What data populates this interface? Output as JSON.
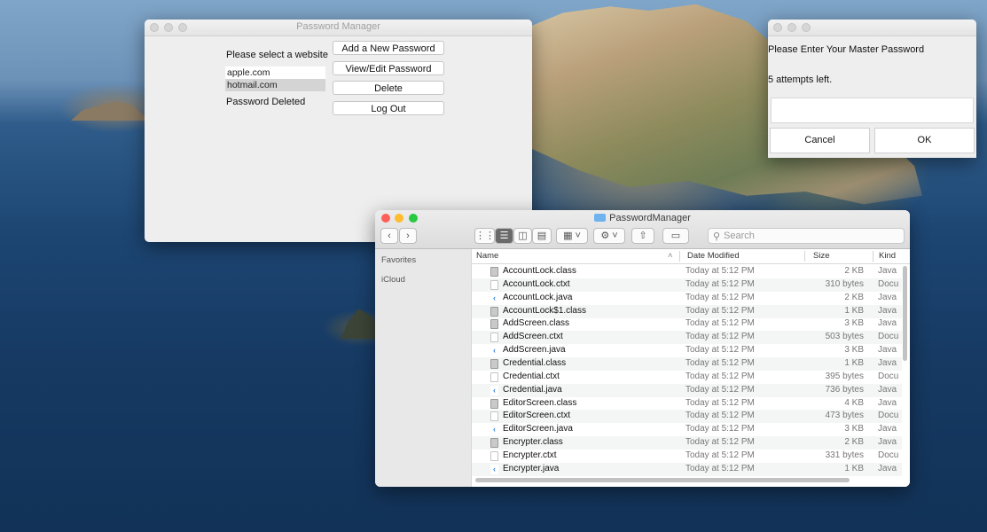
{
  "password_manager": {
    "title": "Password Manager",
    "prompt": "Please select a website",
    "websites": [
      "apple.com",
      "hotmail.com"
    ],
    "selected_index": 1,
    "status": "Password Deleted",
    "buttons": [
      "Add a New Password",
      "View/Edit Password",
      "Delete",
      "Log Out"
    ]
  },
  "master_dialog": {
    "prompt": "Please Enter Your Master Password",
    "attempts": "5 attempts left.",
    "input_value": "",
    "cancel": "Cancel",
    "ok": "OK"
  },
  "finder": {
    "title": "PasswordManager",
    "search_placeholder": "Search",
    "sidebar": [
      "Favorites",
      "iCloud"
    ],
    "columns": {
      "name": "Name",
      "date": "Date Modified",
      "size": "Size",
      "kind": "Kind"
    },
    "files": [
      {
        "name": "AccountLock.class",
        "date": "Today at 5:12 PM",
        "size": "2 KB",
        "kind": "Java",
        "icon": "class-file-icon"
      },
      {
        "name": "AccountLock.ctxt",
        "date": "Today at 5:12 PM",
        "size": "310 bytes",
        "kind": "Docu",
        "icon": "document-icon"
      },
      {
        "name": "AccountLock.java",
        "date": "Today at 5:12 PM",
        "size": "2 KB",
        "kind": "Java",
        "icon": "java-file-icon"
      },
      {
        "name": "AccountLock$1.class",
        "date": "Today at 5:12 PM",
        "size": "1 KB",
        "kind": "Java",
        "icon": "class-file-icon"
      },
      {
        "name": "AddScreen.class",
        "date": "Today at 5:12 PM",
        "size": "3 KB",
        "kind": "Java",
        "icon": "class-file-icon"
      },
      {
        "name": "AddScreen.ctxt",
        "date": "Today at 5:12 PM",
        "size": "503 bytes",
        "kind": "Docu",
        "icon": "document-icon"
      },
      {
        "name": "AddScreen.java",
        "date": "Today at 5:12 PM",
        "size": "3 KB",
        "kind": "Java",
        "icon": "java-file-icon"
      },
      {
        "name": "Credential.class",
        "date": "Today at 5:12 PM",
        "size": "1 KB",
        "kind": "Java",
        "icon": "class-file-icon"
      },
      {
        "name": "Credential.ctxt",
        "date": "Today at 5:12 PM",
        "size": "395 bytes",
        "kind": "Docu",
        "icon": "document-icon"
      },
      {
        "name": "Credential.java",
        "date": "Today at 5:12 PM",
        "size": "736 bytes",
        "kind": "Java",
        "icon": "java-file-icon"
      },
      {
        "name": "EditorScreen.class",
        "date": "Today at 5:12 PM",
        "size": "4 KB",
        "kind": "Java",
        "icon": "class-file-icon"
      },
      {
        "name": "EditorScreen.ctxt",
        "date": "Today at 5:12 PM",
        "size": "473 bytes",
        "kind": "Docu",
        "icon": "document-icon"
      },
      {
        "name": "EditorScreen.java",
        "date": "Today at 5:12 PM",
        "size": "3 KB",
        "kind": "Java",
        "icon": "java-file-icon"
      },
      {
        "name": "Encrypter.class",
        "date": "Today at 5:12 PM",
        "size": "2 KB",
        "kind": "Java",
        "icon": "class-file-icon"
      },
      {
        "name": "Encrypter.ctxt",
        "date": "Today at 5:12 PM",
        "size": "331 bytes",
        "kind": "Docu",
        "icon": "document-icon"
      },
      {
        "name": "Encrypter.java",
        "date": "Today at 5:12 PM",
        "size": "1 KB",
        "kind": "Java",
        "icon": "java-file-icon"
      }
    ]
  },
  "colors": {
    "close": "#ff5f57",
    "minimize": "#febc2e",
    "zoom": "#28c840",
    "folder": "#6eb2ee"
  }
}
